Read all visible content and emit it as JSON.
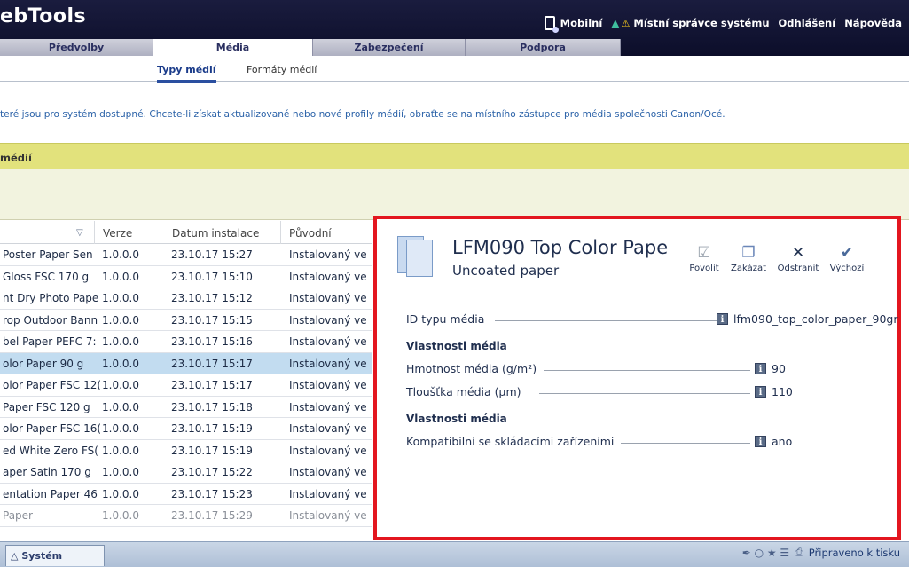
{
  "app": {
    "brand": "ebTools",
    "top_links": {
      "mobile": "Mobilní",
      "admin": "Místní správce systému",
      "logout": "Odhlášení",
      "help": "Nápověda"
    },
    "main_tabs": [
      "Předvolby",
      "Média",
      "Zabezpečení",
      "Podpora"
    ],
    "sub_tabs": [
      "Typy médií",
      "Formáty médií"
    ]
  },
  "page": {
    "info_text": "teré jsou pro systém dostupné. Chcete-li získat aktualizované nebo nové profily médií, obraťte se na místního zástupce pro média společnosti Canon/Océ.",
    "section_title": "médií"
  },
  "table": {
    "headers": {
      "version": "Verze",
      "date": "Datum instalace",
      "origin": "Původní"
    },
    "rows": [
      {
        "name": "Poster Paper Sen",
        "version": "1.0.0.0",
        "date": "23.10.17 15:27",
        "origin": "Instalovaný ve"
      },
      {
        "name": "Gloss FSC 170 g",
        "version": "1.0.0.0",
        "date": "23.10.17 15:10",
        "origin": "Instalovaný ve"
      },
      {
        "name": "nt Dry Photo Pape",
        "version": "1.0.0.0",
        "date": "23.10.17 15:12",
        "origin": "Instalovaný ve"
      },
      {
        "name": "rop Outdoor Bann",
        "version": "1.0.0.0",
        "date": "23.10.17 15:15",
        "origin": "Instalovaný ve"
      },
      {
        "name": "bel Paper PEFC 7:",
        "version": "1.0.0.0",
        "date": "23.10.17 15:16",
        "origin": "Instalovaný ve"
      },
      {
        "name": "olor Paper 90 g",
        "version": "1.0.0.0",
        "date": "23.10.17 15:17",
        "origin": "Instalovaný ve"
      },
      {
        "name": "olor Paper FSC 12(",
        "version": "1.0.0.0",
        "date": "23.10.17 15:17",
        "origin": "Instalovaný ve"
      },
      {
        "name": "Paper FSC 120 g",
        "version": "1.0.0.0",
        "date": "23.10.17 15:18",
        "origin": "Instalovaný ve"
      },
      {
        "name": "olor Paper FSC 16(",
        "version": "1.0.0.0",
        "date": "23.10.17 15:19",
        "origin": "Instalovaný ve"
      },
      {
        "name": "ed White Zero FS(",
        "version": "1.0.0.0",
        "date": "23.10.17 15:19",
        "origin": "Instalovaný ve"
      },
      {
        "name": "aper Satin 170 g",
        "version": "1.0.0.0",
        "date": "23.10.17 15:22",
        "origin": "Instalovaný ve"
      },
      {
        "name": "entation Paper 46",
        "version": "1.0.0.0",
        "date": "23.10.17 15:23",
        "origin": "Instalovaný ve"
      },
      {
        "name": "Paper",
        "version": "1.0.0.0",
        "date": "23.10.17 15:29",
        "origin": "Instalovaný ve"
      }
    ],
    "selected_index": 5
  },
  "detail": {
    "title": "LFM090 Top Color Pape",
    "subtitle": "Uncoated paper",
    "actions": {
      "enable": "Povolit",
      "disable": "Zakázat",
      "remove": "Odstranit",
      "default": "Výchozí"
    },
    "id_label": "ID typu média",
    "id_value": "lfm090_top_color_paper_90gr",
    "section1": "Vlastnosti média",
    "weight_label": "Hmotnost média (g/m²)",
    "weight_value": "90",
    "thickness_label": "Tloušťka média (µm)",
    "thickness_value": "110",
    "section2": "Vlastnosti média",
    "folder_label": "Kompatibilní se skládacími zařízeními",
    "folder_value": "ano"
  },
  "status": {
    "system_tab": "Systém",
    "ready": "Připraveno k tisku"
  },
  "colors": {
    "header_bg": "#0c0e2a",
    "section_yellow": "#e2e27c",
    "selected_row": "#c2dcf0",
    "highlight_border": "#e3161f"
  }
}
